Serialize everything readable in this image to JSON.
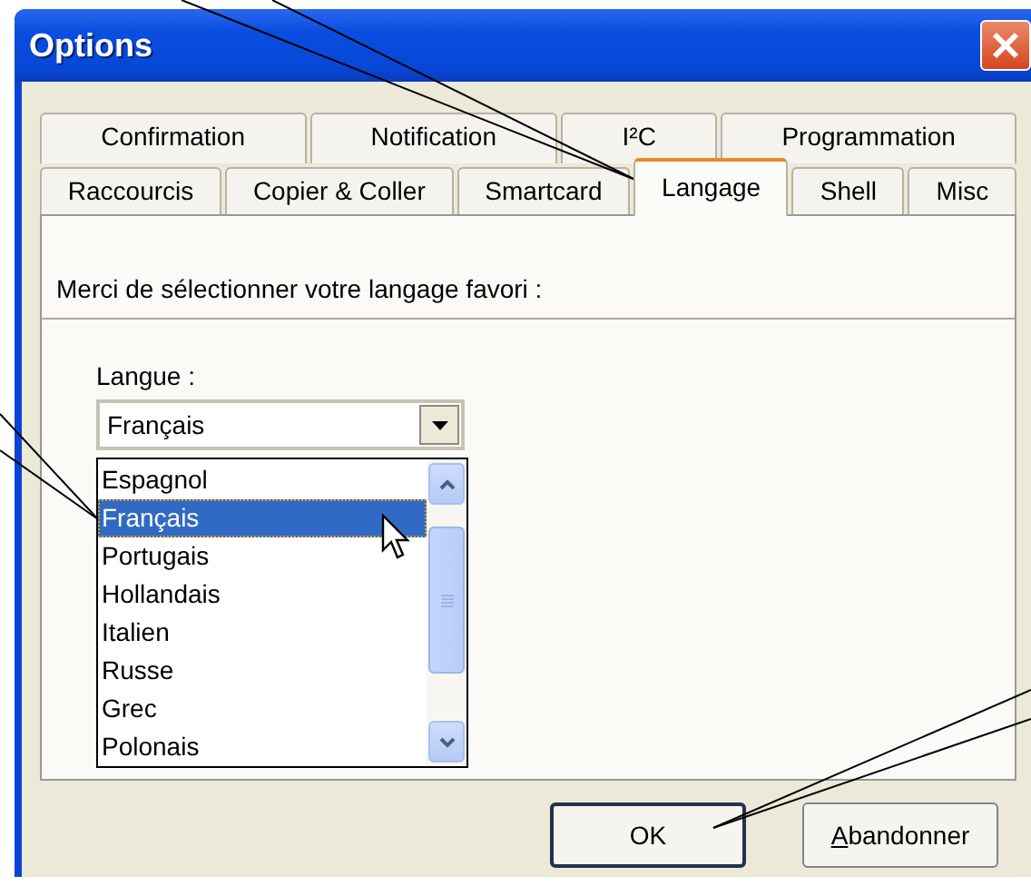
{
  "window": {
    "title": "Options"
  },
  "tabs": [
    [
      {
        "label": "Confirmation",
        "selected": false
      },
      {
        "label": "Notification",
        "selected": false
      },
      {
        "label": "I²C",
        "selected": false
      },
      {
        "label": "Programmation",
        "selected": false
      }
    ],
    [
      {
        "label": "Raccourcis",
        "selected": false
      },
      {
        "label": "Copier & Coller",
        "selected": false
      },
      {
        "label": "Smartcard",
        "selected": false
      },
      {
        "label": "Langage",
        "selected": true
      },
      {
        "label": "Shell",
        "selected": false
      },
      {
        "label": "Misc",
        "selected": false
      }
    ]
  ],
  "panel": {
    "heading": "Merci de sélectionner votre langage favori :",
    "field_label": "Langue :",
    "combo_value": "Français",
    "list_items": [
      {
        "label": "Espagnol",
        "selected": false
      },
      {
        "label": "Français",
        "selected": true
      },
      {
        "label": "Portugais",
        "selected": false
      },
      {
        "label": "Hollandais",
        "selected": false
      },
      {
        "label": "Italien",
        "selected": false
      },
      {
        "label": "Russe",
        "selected": false
      },
      {
        "label": "Grec",
        "selected": false
      },
      {
        "label": "Polonais",
        "selected": false
      }
    ]
  },
  "buttons": [
    {
      "label": "OK",
      "default": true,
      "mnemonic_underlined": false
    },
    {
      "label": "Abandonner",
      "default": false,
      "mnemonic_underlined": true
    }
  ]
}
